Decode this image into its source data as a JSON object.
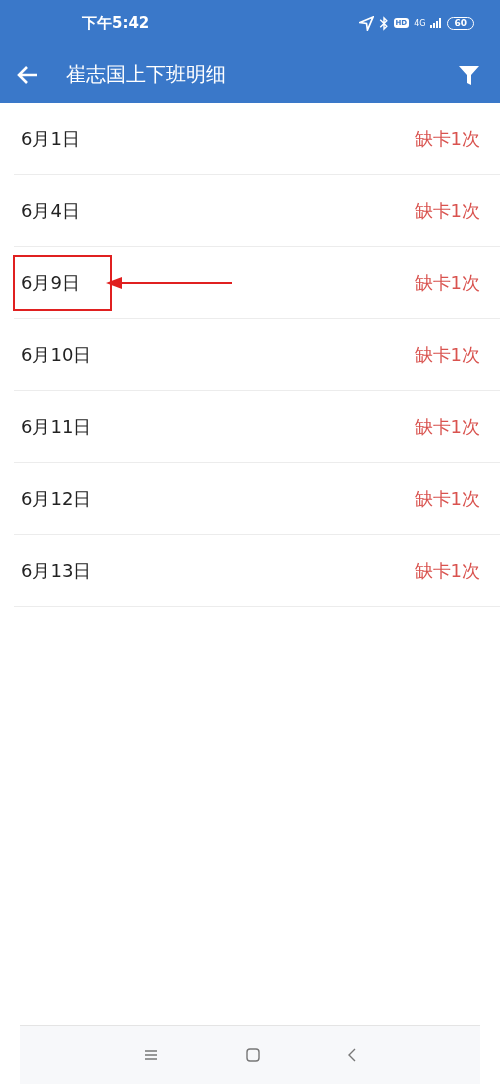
{
  "status_bar": {
    "time": "下午5:42",
    "hd": "HD",
    "network": "4G",
    "battery": "60"
  },
  "header": {
    "title": "崔志国上下班明细"
  },
  "rows": [
    {
      "date": "6月1日",
      "status": "缺卡1次",
      "highlighted": false
    },
    {
      "date": "6月4日",
      "status": "缺卡1次",
      "highlighted": false
    },
    {
      "date": "6月9日",
      "status": "缺卡1次",
      "highlighted": true
    },
    {
      "date": "6月10日",
      "status": "缺卡1次",
      "highlighted": false
    },
    {
      "date": "6月11日",
      "status": "缺卡1次",
      "highlighted": false
    },
    {
      "date": "6月12日",
      "status": "缺卡1次",
      "highlighted": false
    },
    {
      "date": "6月13日",
      "status": "缺卡1次",
      "highlighted": false
    }
  ]
}
